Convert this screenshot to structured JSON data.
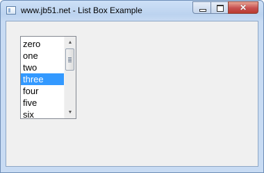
{
  "window": {
    "title": "www.jb51.net - List Box Example",
    "close_glyph": "✕"
  },
  "listbox": {
    "items": [
      "zero",
      "one",
      "two",
      "three",
      "four",
      "five",
      "six"
    ],
    "selected_index": 3,
    "scroll_up_glyph": "▲",
    "scroll_down_glyph": "▼"
  },
  "colors": {
    "selection": "#3399ff",
    "client_background": "#f0f0f0",
    "close_button": "#c75050"
  },
  "icons": [
    "app-window-icon",
    "minimize-icon",
    "maximize-icon",
    "close-icon",
    "scroll-up-icon",
    "scroll-down-icon"
  ]
}
